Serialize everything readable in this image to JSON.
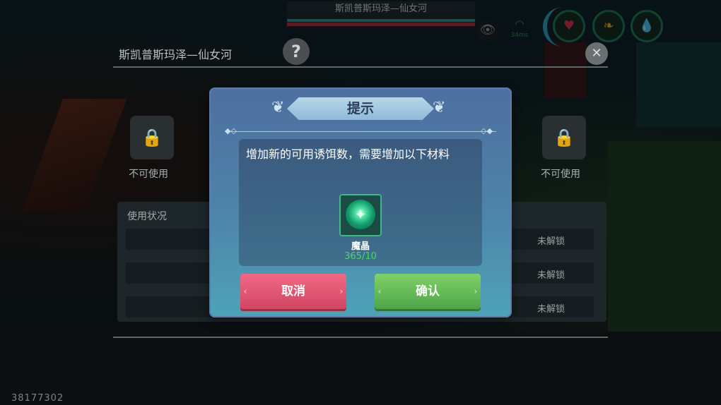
{
  "hud": {
    "location": "斯凯普斯玛泽—仙女河",
    "ping": "34ms",
    "icons": [
      "eye-icon",
      "signal-icon",
      "heart-icon",
      "stomach-icon",
      "water-drop-icon"
    ]
  },
  "background_panel": {
    "title": "斯凯普斯玛泽—仙女河",
    "help_glyph": "?",
    "left_slot_label": "不可使用",
    "right_slot_label": "不可使用",
    "usage_title": "使用状况",
    "rows": [
      "未解锁",
      "未解锁",
      "未解锁"
    ]
  },
  "dialog": {
    "title": "提示",
    "message": "增加新的可用诱饵数，需要增加以下材料",
    "item": {
      "name": "魔晶",
      "count": "365/10"
    },
    "cancel_label": "取消",
    "confirm_label": "确认"
  },
  "footer": {
    "player_id": "38177302"
  },
  "colors": {
    "cancel": "#e0516f",
    "confirm": "#64b955",
    "count": "#46d86a",
    "dialog": "#4e7aa6"
  }
}
